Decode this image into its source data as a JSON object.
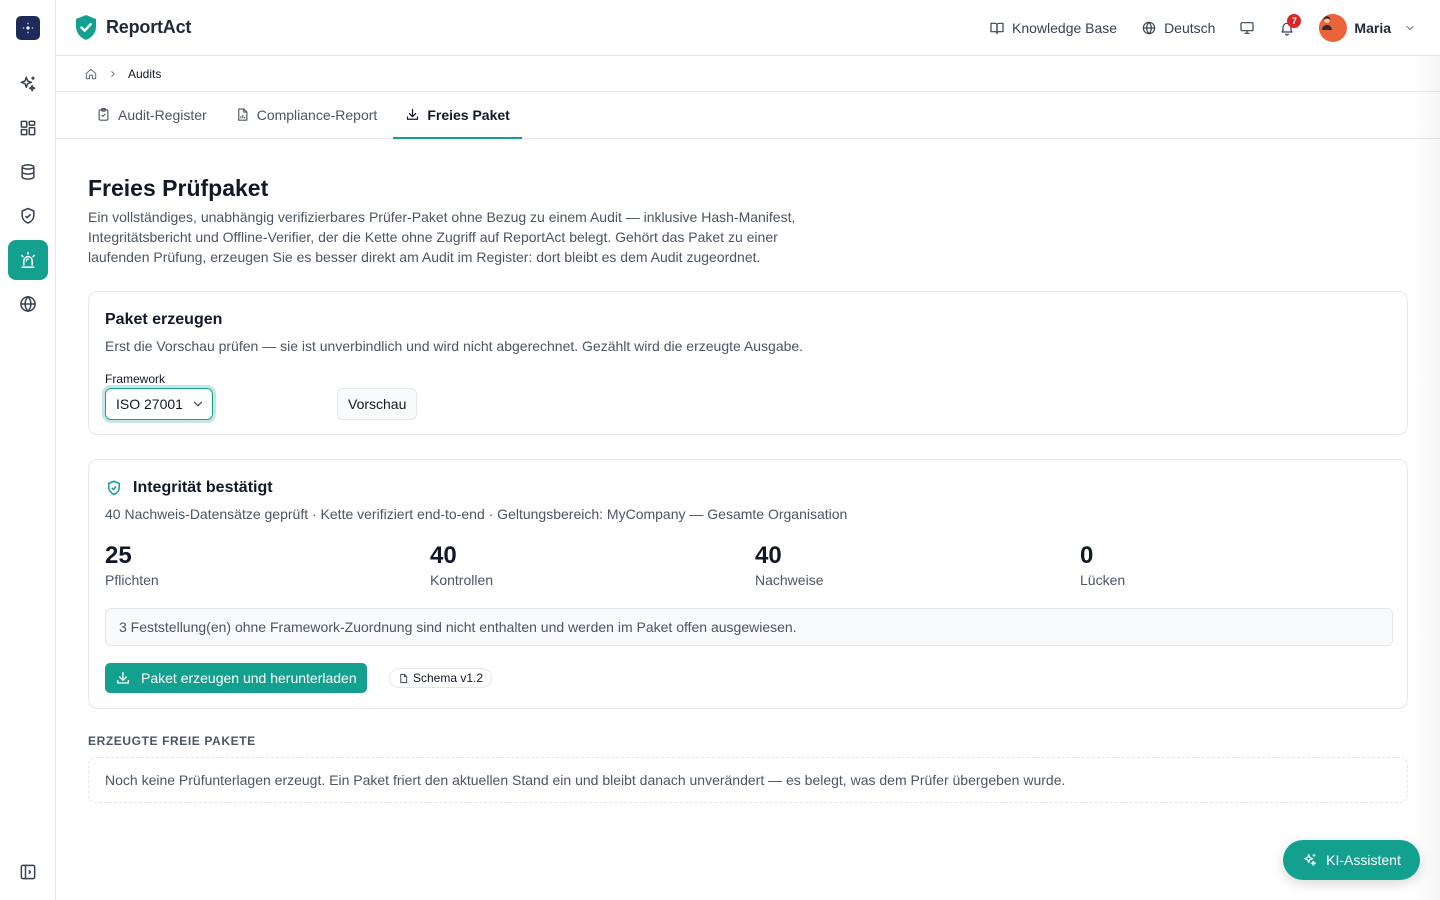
{
  "brand": {
    "name": "ReportAct"
  },
  "topbar": {
    "knowledge_base": "Knowledge Base",
    "language": "Deutsch",
    "notification_count": "7",
    "user_name": "Maria"
  },
  "breadcrumb": {
    "current": "Audits"
  },
  "tabs": [
    {
      "label": "Audit-Register"
    },
    {
      "label": "Compliance-Report"
    },
    {
      "label": "Freies Paket"
    }
  ],
  "page": {
    "title": "Freies Prüfpaket",
    "description": "Ein vollständiges, unabhängig verifizierbares Prüfer-Paket ohne Bezug zu einem Audit — inklusive Hash-Manifest, Integritätsbericht und Offline-Verifier, der die Kette ohne Zugriff auf ReportAct belegt. Gehört das Paket zu einer laufenden Prüfung, erzeugen Sie es besser direkt am Audit im Register: dort bleibt es dem Audit zugeordnet."
  },
  "generate": {
    "title": "Paket erzeugen",
    "subtitle": "Erst die Vorschau prüfen — sie ist unverbindlich und wird nicht abgerechnet. Gezählt wird die erzeugte Ausgabe.",
    "framework_label": "Framework",
    "framework_value": "ISO 27001",
    "preview_button": "Vorschau"
  },
  "integrity": {
    "title": "Integrität bestätigt",
    "subtitle": "40 Nachweis-Datensätze geprüft · Kette verifiziert end-to-end · Geltungsbereich: MyCompany — Gesamte Organisation",
    "stats": [
      {
        "value": "25",
        "label": "Pflichten"
      },
      {
        "value": "40",
        "label": "Kontrollen"
      },
      {
        "value": "40",
        "label": "Nachweise"
      },
      {
        "value": "0",
        "label": "Lücken"
      }
    ],
    "note": "3 Feststellung(en) ohne Framework-Zuordnung sind nicht enthalten und werden im Paket offen ausgewiesen.",
    "download_button": "Paket erzeugen und herunterladen",
    "schema": "Schema v1.2"
  },
  "generated": {
    "heading": "ERZEUGTE FREIE PAKETE",
    "empty": "Noch keine Prüfunterlagen erzeugt. Ein Paket friert den aktuellen Stand ein und bleibt danach unverändert — es belegt, was dem Prüfer übergeben wurde."
  },
  "assistant": {
    "label": "KI-Assistent"
  },
  "colors": {
    "accent": "#14a08f",
    "rail_logo": "#1e2a5a",
    "badge": "#dc2626"
  }
}
